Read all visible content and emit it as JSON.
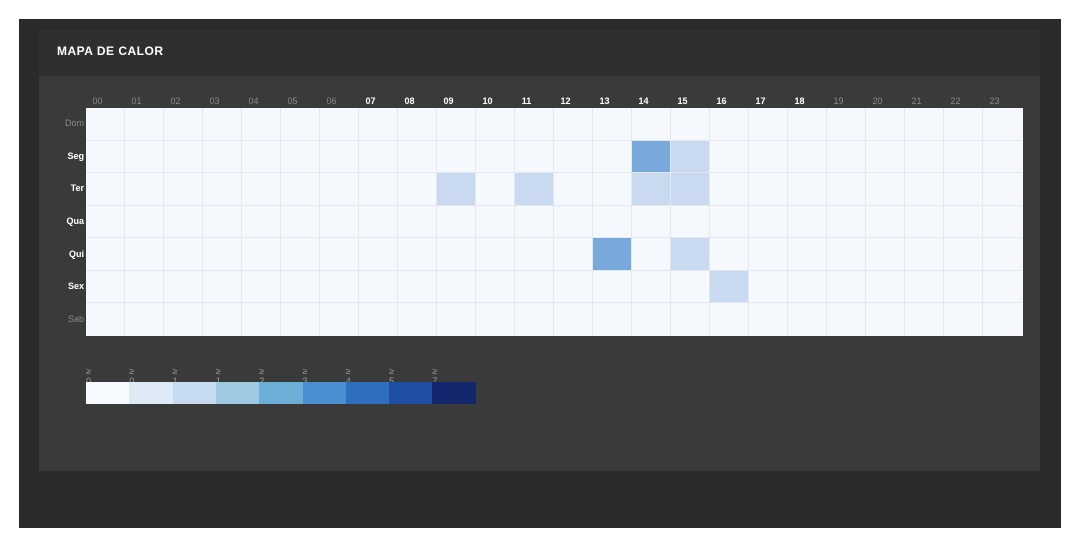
{
  "panel": {
    "title": "MAPA DE CALOR"
  },
  "chart_data": {
    "type": "heatmap",
    "x": [
      "00",
      "01",
      "02",
      "03",
      "04",
      "05",
      "06",
      "07",
      "08",
      "09",
      "10",
      "11",
      "12",
      "13",
      "14",
      "15",
      "16",
      "17",
      "18",
      "19",
      "20",
      "21",
      "22",
      "23"
    ],
    "y": [
      "Dom",
      "Seg",
      "Ter",
      "Qua",
      "Qui",
      "Sex",
      "Sab"
    ],
    "highlighted_x": [
      "07",
      "08",
      "09",
      "10",
      "11",
      "12",
      "13",
      "14",
      "15",
      "16",
      "17",
      "18"
    ],
    "highlighted_y": [
      "Seg",
      "Ter",
      "Qua",
      "Qui",
      "Sex"
    ],
    "values": [
      [
        0,
        0,
        0,
        0,
        0,
        0,
        0,
        0,
        0,
        0,
        0,
        0,
        0,
        0,
        0,
        0,
        0,
        0,
        0,
        0,
        0,
        0,
        0,
        0
      ],
      [
        0,
        0,
        0,
        0,
        0,
        0,
        0,
        0,
        0,
        0,
        0,
        0,
        0,
        0,
        3,
        1,
        0,
        0,
        0,
        0,
        0,
        0,
        0,
        0
      ],
      [
        0,
        0,
        0,
        0,
        0,
        0,
        0,
        0,
        0,
        1,
        0,
        1,
        0,
        0,
        1,
        1,
        0,
        0,
        0,
        0,
        0,
        0,
        0,
        0
      ],
      [
        0,
        0,
        0,
        0,
        0,
        0,
        0,
        0,
        0,
        0,
        0,
        0,
        0,
        0,
        0,
        0,
        0,
        0,
        0,
        0,
        0,
        0,
        0,
        0
      ],
      [
        0,
        0,
        0,
        0,
        0,
        0,
        0,
        0,
        0,
        0,
        0,
        0,
        0,
        3,
        0,
        1,
        0,
        0,
        0,
        0,
        0,
        0,
        0,
        0
      ],
      [
        0,
        0,
        0,
        0,
        0,
        0,
        0,
        0,
        0,
        0,
        0,
        0,
        0,
        0,
        0,
        0,
        1,
        0,
        0,
        0,
        0,
        0,
        0,
        0
      ],
      [
        0,
        0,
        0,
        0,
        0,
        0,
        0,
        0,
        0,
        0,
        0,
        0,
        0,
        0,
        0,
        0,
        0,
        0,
        0,
        0,
        0,
        0,
        0,
        0
      ]
    ],
    "legend": {
      "labels": [
        "≥ 0",
        "≥ 0",
        "≥ 1",
        "≥ 1",
        "≥ 2",
        "≥ 3",
        "≥ 4",
        "≥ 5",
        "≥ 7"
      ],
      "colors": [
        "#f7fbff",
        "#deebf7",
        "#c6dbef",
        "#9ecae1",
        "#6baed6",
        "#4a90d0",
        "#2f6fc0",
        "#1f4ea3",
        "#13266d"
      ]
    },
    "value_colors": {
      "0": "#f5f9fd",
      "1": "#c9daf0",
      "3": "#78a9da"
    }
  }
}
